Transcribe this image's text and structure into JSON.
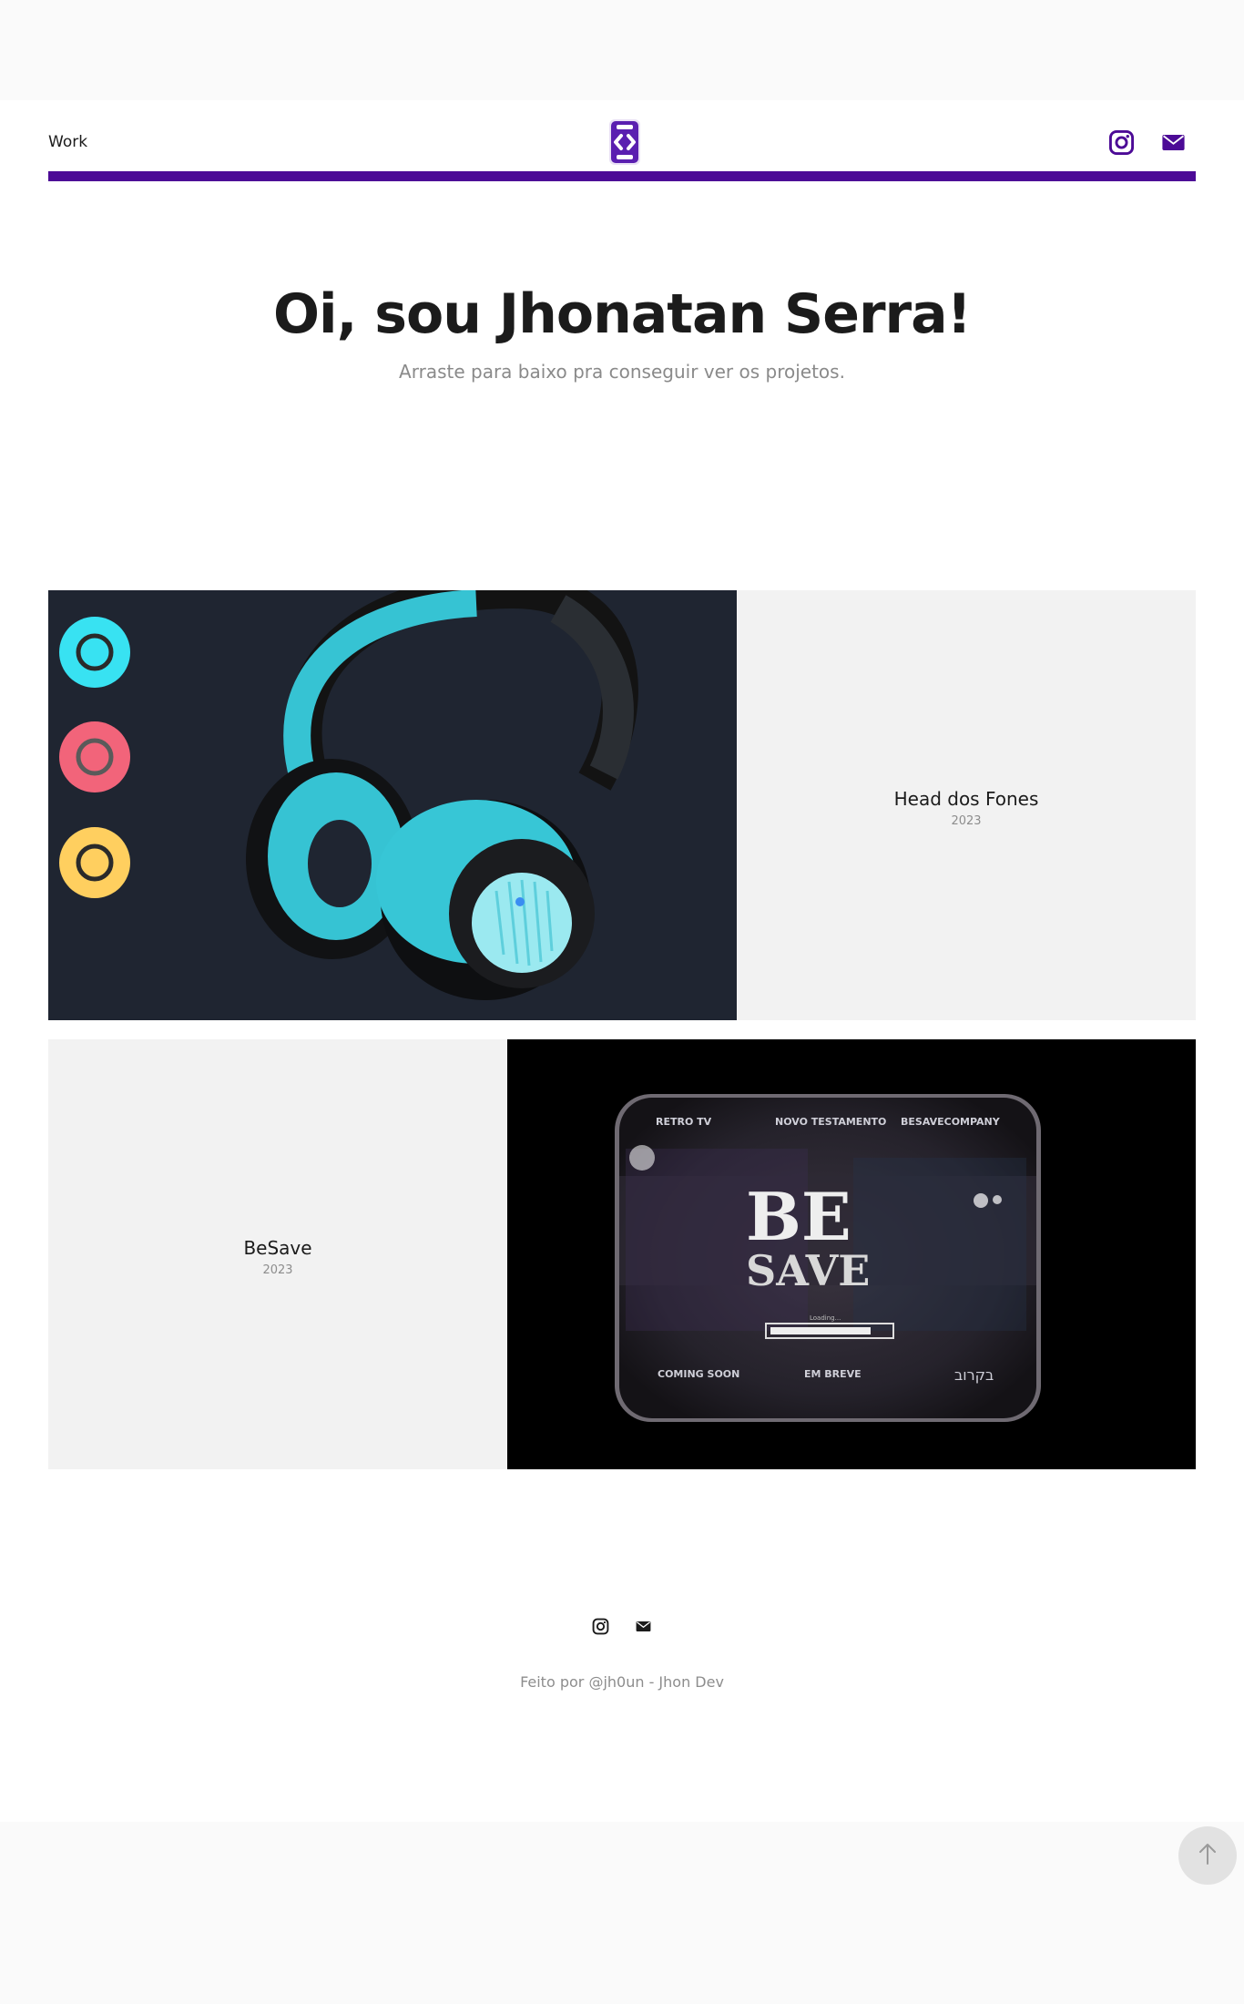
{
  "header": {
    "nav_work": "Work",
    "logo_icon": "code-brackets-logo",
    "instagram_icon": "instagram-icon",
    "email_icon": "envelope-icon",
    "accent": "#4c0a96"
  },
  "hero": {
    "title": "Oi, sou Jhonatan Serra!",
    "subtitle": "Arraste para baixo pra conseguir ver os projetos."
  },
  "projects": [
    {
      "name": "Head dos Fones",
      "year": "2023",
      "image": "headphones-product-image"
    },
    {
      "name": "BeSave",
      "year": "2023",
      "image": "retro-tv-image",
      "tv_labels": {
        "top_left": "RETRO TV",
        "top_mid": "NOVO TESTAMENTO",
        "top_right": "BESAVECOMPANY",
        "logo_line1": "BE",
        "logo_line2": "SAVE",
        "loading": "Loading...",
        "bottom_left": "COMING SOON",
        "bottom_mid": "EM BREVE",
        "bottom_right": "בקרוב"
      }
    }
  ],
  "footer": {
    "text": "Feito por @jh0un - Jhon Dev",
    "instagram_icon": "instagram-icon",
    "email_icon": "envelope-icon"
  },
  "back_to_top_icon": "arrow-up-icon"
}
